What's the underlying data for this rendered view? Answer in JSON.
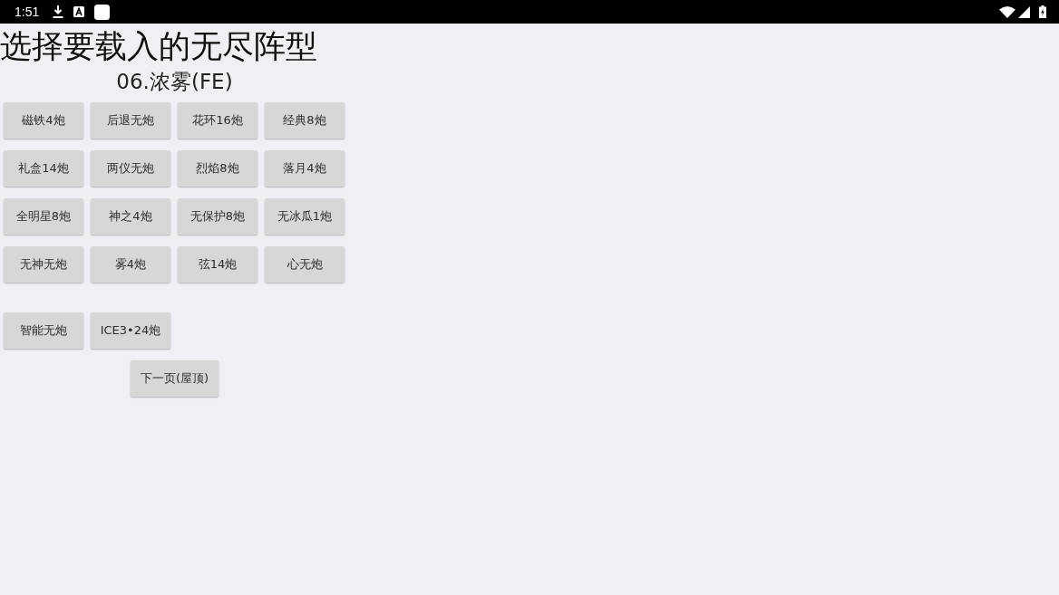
{
  "status_bar": {
    "time": "1:51"
  },
  "title": "选择要载入的无尽阵型",
  "subtitle": "06.浓雾(FE)",
  "formation_buttons": [
    "磁铁4炮",
    "后退无炮",
    "花环16炮",
    "经典8炮",
    "礼盒14炮",
    "两仪无炮",
    "烈焰8炮",
    "落月4炮",
    "全明星8炮",
    "神之4炮",
    "无保护8炮",
    "无冰瓜1炮",
    "无神无炮",
    "雾4炮",
    "弦14炮",
    "心无炮"
  ],
  "extra_buttons": [
    "智能无炮",
    "ICE3•24炮"
  ],
  "next_page_button": "下一页(屋顶)"
}
